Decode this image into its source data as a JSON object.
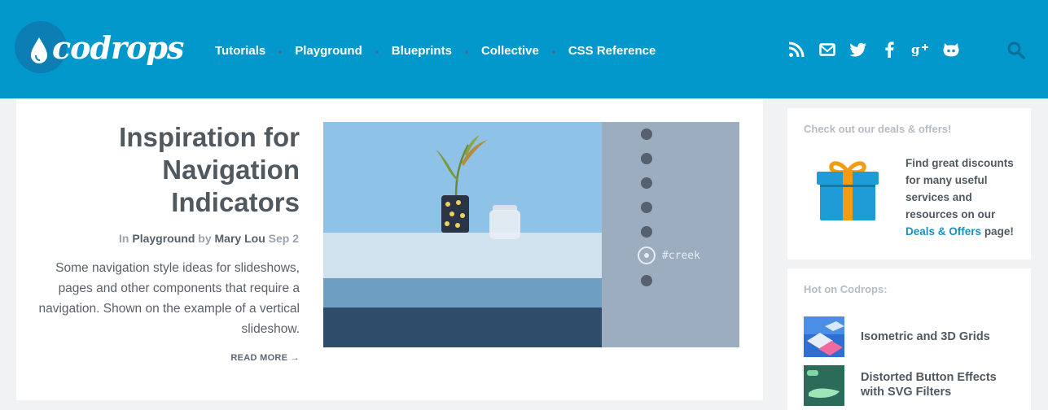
{
  "header": {
    "logo_text": "codrops",
    "nav": [
      "Tutorials",
      "Playground",
      "Blueprints",
      "Collective",
      "CSS Reference"
    ],
    "social_icons": [
      "rss-icon",
      "mail-icon",
      "twitter-icon",
      "facebook-icon",
      "google-plus-icon",
      "github-icon"
    ],
    "search_icon": "search-icon",
    "colors": {
      "bar": "#0298cc",
      "logo_circle": "#0c7eb4"
    }
  },
  "article": {
    "title_lines": [
      "Inspiration for",
      "Navigation",
      "Indicators"
    ],
    "meta": {
      "prefix": "In",
      "category": "Playground",
      "by": "by",
      "author": "Mary Lou",
      "date": "Sep 2"
    },
    "excerpt": "Some navigation style ideas for slideshows, pages and other components that require a navigation. Shown on the example of a vertical slideshow.",
    "read_more": "READ MORE",
    "thumbnail_label": "#creek"
  },
  "sidebar": {
    "deals": {
      "heading": "Check out our deals & offers!",
      "text": "Find great discounts for many useful services and resources on our",
      "link": "Deals & Offers",
      "suffix": "page!"
    },
    "hot": {
      "heading": "Hot on Codrops:",
      "items": [
        {
          "title_lines": [
            "Isometric and 3D Grids"
          ]
        },
        {
          "title_lines": [
            "Distorted Button Effects",
            "with SVG Filters"
          ]
        }
      ]
    }
  }
}
